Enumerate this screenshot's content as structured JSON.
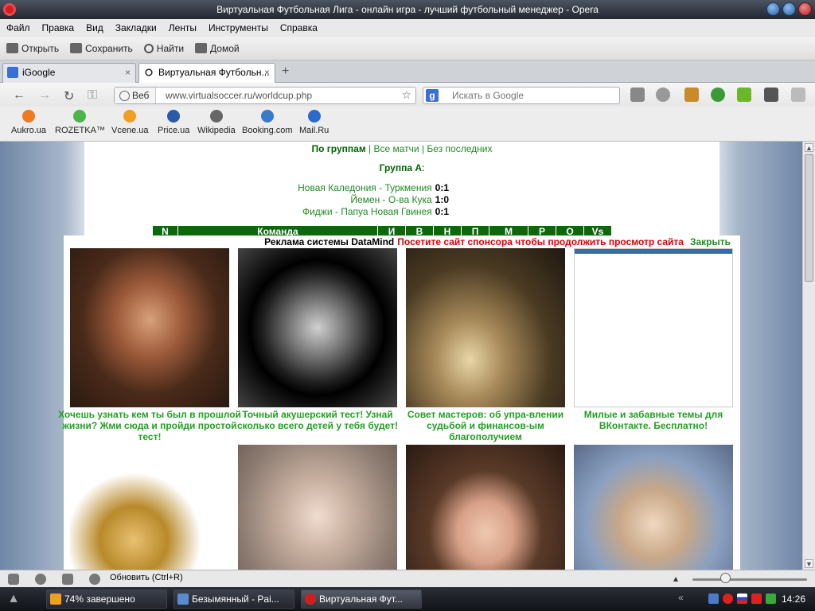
{
  "window": {
    "title": "Виртуальная Футбольная Лига - онлайн игра - лучший футбольный менеджер - Opera"
  },
  "menu": [
    "Файл",
    "Правка",
    "Вид",
    "Закладки",
    "Ленты",
    "Инструменты",
    "Справка"
  ],
  "toolbar": {
    "open": "Открыть",
    "save": "Сохранить",
    "find": "Найти",
    "home": "Домой"
  },
  "tabs": [
    {
      "label": "iGoogle",
      "favicon": "google-icon",
      "close": "×"
    },
    {
      "label": "Виртуальная Футбольн...",
      "favicon": "soccer-ball-icon",
      "close": "×"
    }
  ],
  "newtab": "+",
  "address": {
    "web_label": "Веб",
    "url": "www.virtualsoccer.ru/worldcup.php",
    "search_placeholder": "Искать в Google",
    "search_logo": "g"
  },
  "bookmarks": [
    {
      "label": "Aukro.ua",
      "color": "#f07a1e"
    },
    {
      "label": "ROZETKA™",
      "color": "#4bb44b"
    },
    {
      "label": "Vcene.ua",
      "color": "#f0a020"
    },
    {
      "label": "Price.ua",
      "color": "#2a5aa8"
    },
    {
      "label": "Wikipedia",
      "color": "#666666"
    },
    {
      "label": "Booking.com",
      "color": "#3a7ac8"
    },
    {
      "label": "Mail.Ru",
      "color": "#2a6ac8"
    }
  ],
  "page": {
    "links": {
      "by_group": "По группам",
      "sep1": " | ",
      "all_matches": "Все матчи",
      "sep2": " | ",
      "without_last": "Без последних"
    },
    "group_title": "Группа А",
    "group_suffix": ":",
    "matches": [
      {
        "teams": "Новая Каледония - Туркмения",
        "score": "0:1"
      },
      {
        "teams": "Йемен - О-ва Кука",
        "score": "1:0"
      },
      {
        "teams": "Фиджи - Папуа Новая Гвинея",
        "score": "0:1"
      }
    ],
    "table_headers": [
      "N",
      "Команда",
      "И",
      "В",
      "Н",
      "П",
      "М",
      "Р",
      "О",
      "Vs"
    ]
  },
  "ad": {
    "label": "Реклама системы DataMind",
    "notice": "Посетите сайт спонсора чтобы продолжить просмотр сайта",
    "close": "Закрыть",
    "cards": [
      {
        "caption": "Хочешь узнать кем ты был в прошлой жизни? Жми сюда и пройди простой тест!"
      },
      {
        "caption": "Точный акушерский тест! Узнай сколько всего детей у тебя будет!"
      },
      {
        "caption": "Совет мастеров: об упра-влении судьбой и финансов-ым благополучием"
      },
      {
        "caption": "Милые и забавные темы для ВКонтакте. Бесплатно!"
      },
      {
        "caption": ""
      },
      {
        "caption": ""
      },
      {
        "caption": ""
      },
      {
        "caption": ""
      }
    ]
  },
  "status": {
    "text": "Обновить (Ctrl+R)"
  },
  "taskbar": {
    "tasks": [
      {
        "label": "74% завершено",
        "color": "#f0a020"
      },
      {
        "label": "Безымянный - Pai...",
        "color": "#5a8ad0"
      },
      {
        "label": "Виртуальная Фут...",
        "color": "#d21e1e"
      }
    ],
    "clock": "14:26"
  }
}
